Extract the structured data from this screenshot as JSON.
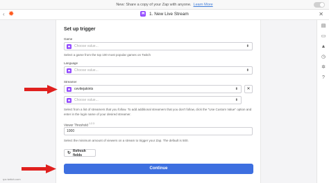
{
  "banner": {
    "text": "New: Share a copy of your Zap with anyone.",
    "link": "Learn More"
  },
  "topbar": {
    "back": "‹",
    "step_title": "1. New Live Stream",
    "close": "✕"
  },
  "panel": {
    "heading": "Set up trigger",
    "game": {
      "label": "Game",
      "placeholder": "Choose value...",
      "help": "Select a game from the top 100 most popular games on Twitch"
    },
    "language": {
      "label": "Language",
      "placeholder": "Choose value..."
    },
    "streamer": {
      "label": "Streamer",
      "value": "cevitejakints",
      "placeholder": "Choose value...",
      "help": "Select from a list of streamers that you follow. To add additional streamers that you don't follow, click the \"Use Custom Value\" option and enter in the login name of your desired streamer."
    },
    "viewer_threshold": {
      "label": "Viewer Threshold",
      "hint": "1.2.3",
      "value": "1000",
      "help": "Select the minimum amount of viewers on a stream to trigger your Zap. The default is 500."
    },
    "refresh_label": "Refresh fields",
    "continue_label": "Continue"
  },
  "footer": {
    "text": "rpc.twitch.com"
  },
  "colors": {
    "accent": "#3d6fe0",
    "twitch": "#9146ff",
    "arrow": "#e0201e",
    "brand": "#ff5a1f"
  },
  "icons": [
    "chevron-left-icon",
    "zapier-logo-icon",
    "twitch-icon",
    "close-icon",
    "updown-chevron-icon",
    "refresh-icon",
    "arrow-right-icon"
  ]
}
